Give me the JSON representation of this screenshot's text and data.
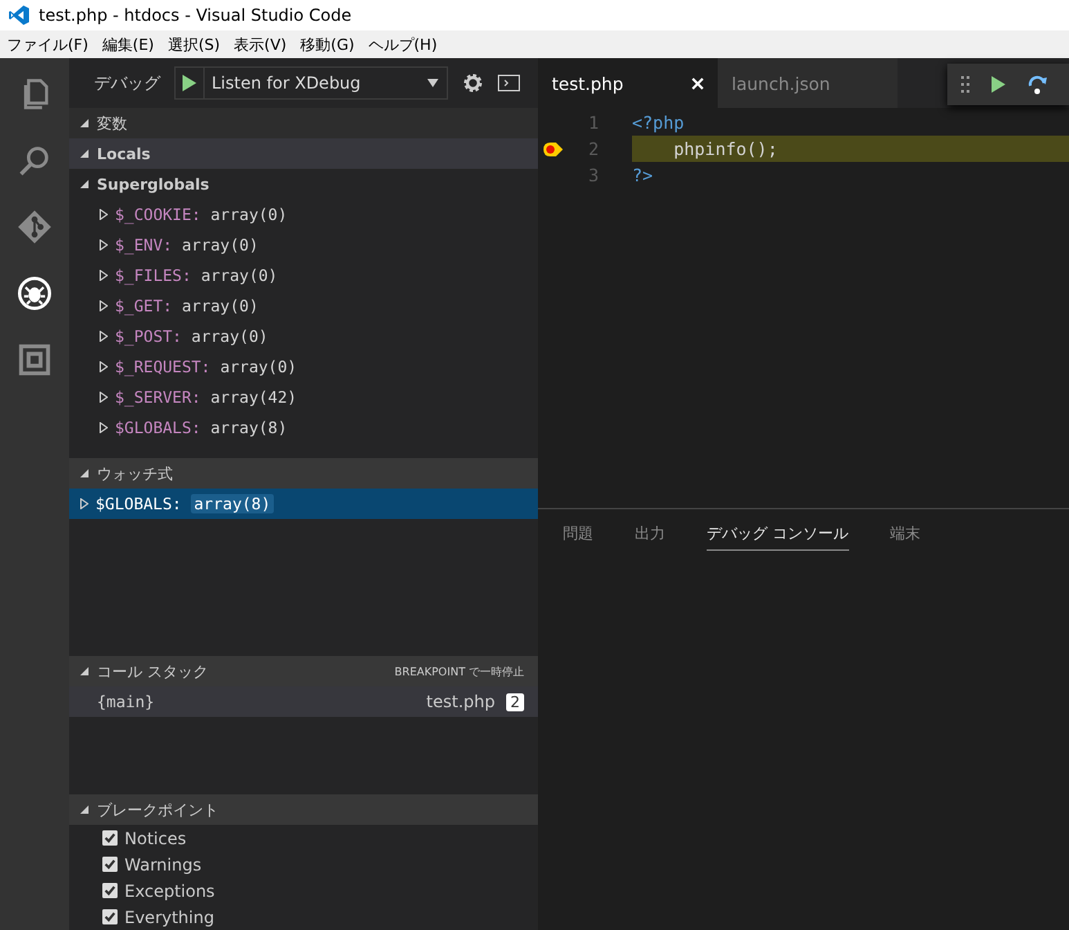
{
  "window": {
    "title": "test.php - htdocs - Visual Studio Code"
  },
  "menu": [
    "ファイル(F)",
    "編集(E)",
    "選択(S)",
    "表示(V)",
    "移動(G)",
    "ヘルプ(H)"
  ],
  "activity_bar": [
    {
      "kind": "files",
      "selected": false
    },
    {
      "kind": "search",
      "selected": false
    },
    {
      "kind": "git",
      "selected": false
    },
    {
      "kind": "debug",
      "selected": true
    },
    {
      "kind": "extensions",
      "selected": false
    }
  ],
  "debug_toolbar": {
    "label": "デバッグ",
    "configuration": "Listen for XDebug"
  },
  "variables": {
    "header": "変数",
    "expanded": true,
    "scopes": [
      {
        "name": "Locals",
        "expanded": true,
        "selected": true
      },
      {
        "name": "Superglobals",
        "expanded": true,
        "selected": false,
        "children": [
          {
            "name": "$_COOKIE:",
            "value": "array(0)",
            "expanded": false
          },
          {
            "name": "$_ENV:",
            "value": "array(0)",
            "expanded": false
          },
          {
            "name": "$_FILES:",
            "value": "array(0)",
            "expanded": false
          },
          {
            "name": "$_GET:",
            "value": "array(0)",
            "expanded": false
          },
          {
            "name": "$_POST:",
            "value": "array(0)",
            "expanded": false
          },
          {
            "name": "$_REQUEST:",
            "value": "array(0)",
            "expanded": false
          },
          {
            "name": "$_SERVER:",
            "value": "array(42)",
            "expanded": false
          },
          {
            "name": "$GLOBALS:",
            "value": "array(8)",
            "expanded": false
          }
        ]
      }
    ]
  },
  "watch": {
    "header": "ウォッチ式",
    "expanded": true,
    "items": [
      {
        "name": "$GLOBALS:",
        "value": "array(8)",
        "expanded": false,
        "selected": true
      }
    ]
  },
  "call_stack": {
    "header": "コール スタック",
    "expanded": true,
    "status": "BREAKPOINT で一時停止",
    "frames": [
      {
        "name": "{main}",
        "file": "test.php",
        "line": "2",
        "selected": true
      }
    ]
  },
  "breakpoints": {
    "header": "ブレークポイント",
    "expanded": true,
    "items": [
      {
        "label": "Notices",
        "checked": true
      },
      {
        "label": "Warnings",
        "checked": true
      },
      {
        "label": "Exceptions",
        "checked": true
      },
      {
        "label": "Everything",
        "checked": true
      }
    ]
  },
  "editor": {
    "tabs": [
      {
        "label": "test.php",
        "selected": true
      },
      {
        "label": "launch.json",
        "selected": false
      }
    ],
    "lines": [
      {
        "number": "1",
        "text": "<?php",
        "kind": "tag",
        "breakpoint": false,
        "current": false
      },
      {
        "number": "2",
        "text": "    phpinfo();",
        "kind": "code",
        "breakpoint": true,
        "current": true
      },
      {
        "number": "3",
        "text": "?>",
        "kind": "tag",
        "breakpoint": false,
        "current": false
      }
    ]
  },
  "panel": {
    "tabs": [
      {
        "label": "問題",
        "selected": false
      },
      {
        "label": "出力",
        "selected": false
      },
      {
        "label": "デバッグ コンソール",
        "selected": true
      },
      {
        "label": "端末",
        "selected": false
      }
    ]
  }
}
